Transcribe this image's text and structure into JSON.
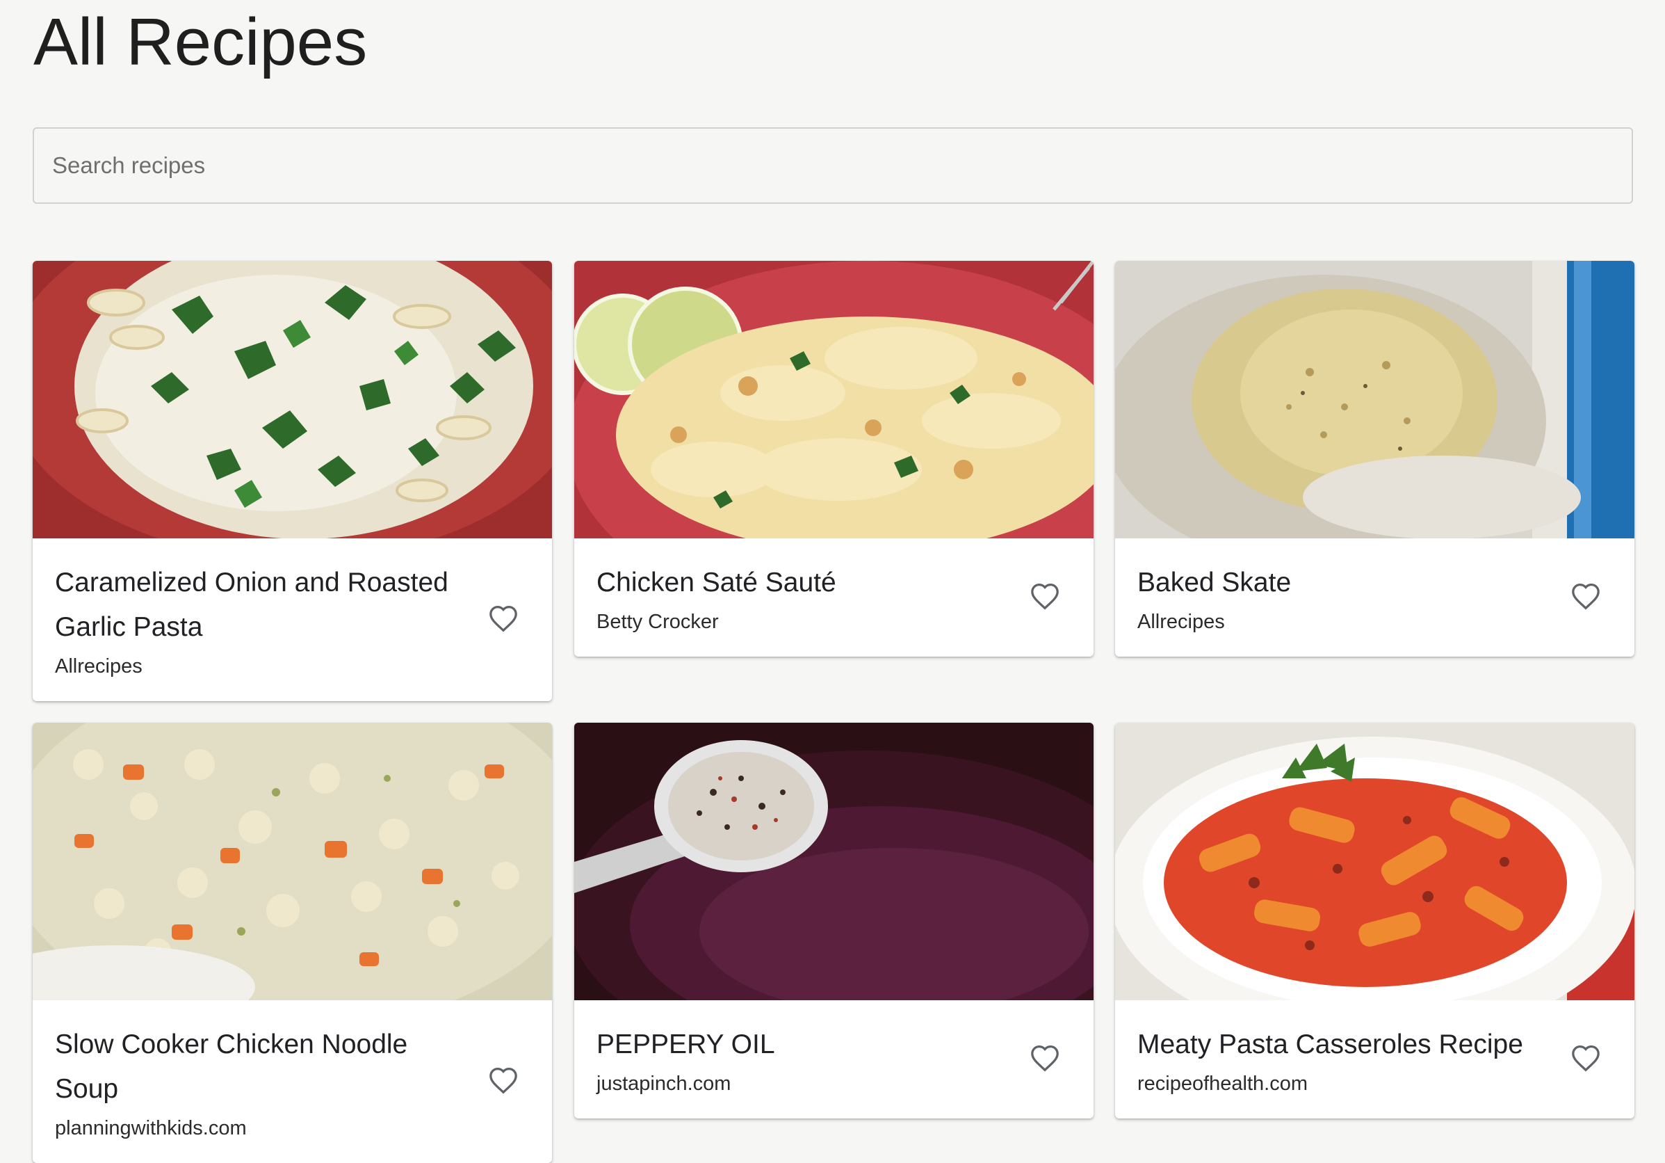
{
  "page": {
    "title": "All Recipes"
  },
  "search": {
    "placeholder": "Search recipes",
    "value": ""
  },
  "recipes": [
    {
      "title": "Caramelized Onion and Roasted Garlic Pasta",
      "source": "Allrecipes",
      "image": "pasta-parmesan-parsley"
    },
    {
      "title": "Chicken Saté Sauté",
      "source": "Betty Crocker",
      "image": "creamy-chicken-pasta"
    },
    {
      "title": "Baked Skate",
      "source": "Allrecipes",
      "image": "baked-fish"
    },
    {
      "title": "Slow Cooker Chicken Noodle Soup",
      "source": "planningwithkids.com",
      "image": "chicken-noodle-soup"
    },
    {
      "title": "PEPPERY OIL",
      "source": "justapinch.com",
      "image": "spice-spoon-oil"
    },
    {
      "title": "Meaty Pasta Casseroles Recipe",
      "source": "recipeofhealth.com",
      "image": "meaty-pasta-bowl"
    }
  ],
  "icons": {
    "favorite": "heart-outline-icon"
  }
}
